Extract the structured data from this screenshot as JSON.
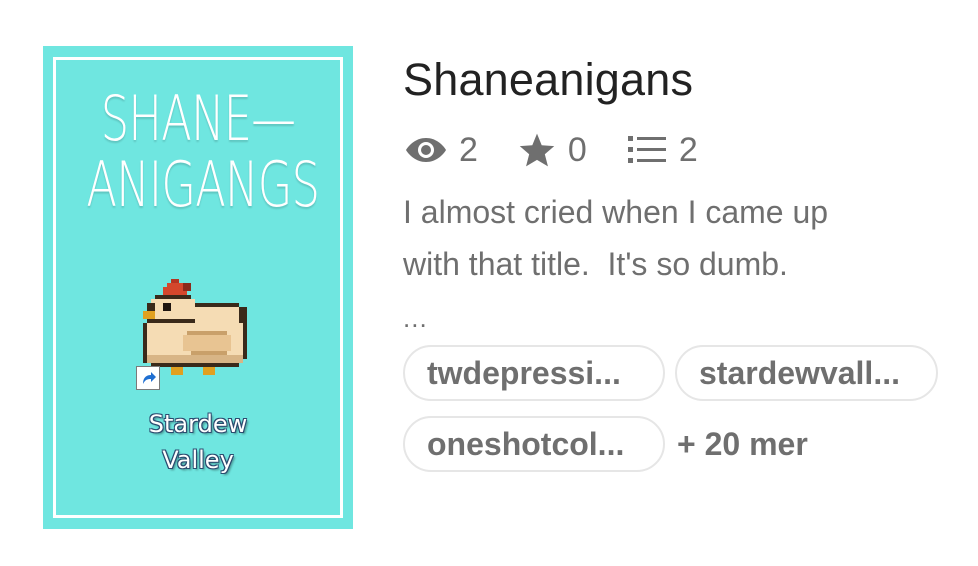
{
  "cover": {
    "title_line1": "SHANE—",
    "title_line2": "ANIGANGS",
    "caption_line1": "Stardew",
    "caption_line2": "Valley",
    "background_color": "#6fe6e0",
    "icon": "chicken-icon"
  },
  "story": {
    "title": "Shaneanigans",
    "stats": {
      "reads": "2",
      "votes": "0",
      "parts": "2"
    },
    "description_line1": "I almost cried when I came up",
    "description_line2": "with that title.  It's so dumb.",
    "description_more": "...",
    "tags": [
      "twdepressi...",
      "stardewvall...",
      "oneshotcol..."
    ],
    "more_tags": "+ 20 mer"
  }
}
